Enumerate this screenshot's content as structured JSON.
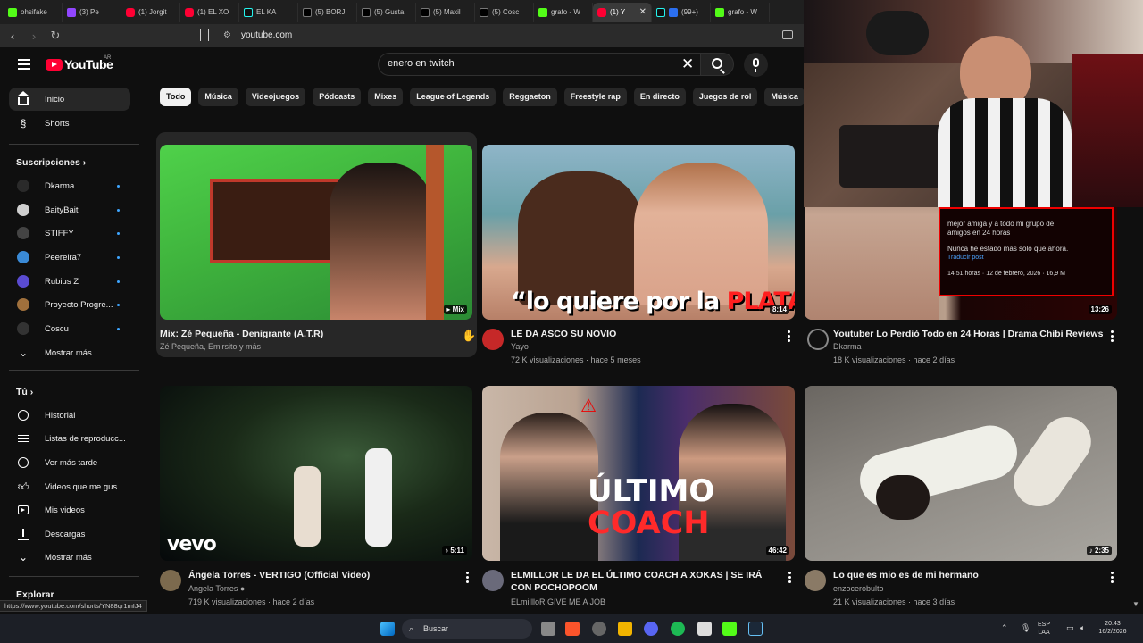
{
  "browser": {
    "tabs": [
      {
        "title": "ohsifake",
        "favicon": "kick-icon"
      },
      {
        "title": "(3) Pe",
        "favicon": "twitch-icon"
      },
      {
        "title": "(1) Jorgit",
        "favicon": "youtube-icon"
      },
      {
        "title": "(1) EL XO",
        "favicon": "youtube-icon"
      },
      {
        "title": "EL KA",
        "favicon": "tiktok-icon"
      },
      {
        "title": "(5) BORJ",
        "favicon": "x-icon"
      },
      {
        "title": "(5) Gusta",
        "favicon": "x-icon"
      },
      {
        "title": "(5) Maxil",
        "favicon": "x-icon"
      },
      {
        "title": "(5) Cosc",
        "favicon": "x-icon"
      },
      {
        "title": "grafo - W",
        "favicon": "kick-icon"
      },
      {
        "title": "(1) Y",
        "favicon": "youtube-icon",
        "active": true
      },
      {
        "title": "(99+)",
        "favicon": "mail-icon"
      },
      {
        "title": "grafo - W",
        "favicon": "kick-icon"
      }
    ],
    "url": "youtube.com",
    "status_url": "https://www.youtube.com/shorts/YN88qr1mIJ4"
  },
  "masthead": {
    "logo_text": "YouTube",
    "country": "AR",
    "search_value": "enero en twitch"
  },
  "sidebar": {
    "main": [
      {
        "label": "Inicio",
        "icon": "home-icon"
      },
      {
        "label": "Shorts",
        "icon": "shorts-icon"
      }
    ],
    "subs_header": "Suscripciones",
    "subscriptions": [
      {
        "label": "Dkarma",
        "color": "#2a2a2a"
      },
      {
        "label": "BaityBait",
        "color": "#cfcfcf"
      },
      {
        "label": "STIFFY",
        "color": "#444444"
      },
      {
        "label": "Peereira7",
        "color": "#3a8ad6"
      },
      {
        "label": "Rubius Z",
        "color": "#5a4bd1"
      },
      {
        "label": "Proyecto Progre...",
        "color": "#a0703c"
      },
      {
        "label": "Coscu",
        "color": "#333333"
      }
    ],
    "show_more": "Mostrar más",
    "you_header": "Tú",
    "you_items": [
      {
        "label": "Historial",
        "icon": "history-icon"
      },
      {
        "label": "Listas de reproducc...",
        "icon": "playlists-icon"
      },
      {
        "label": "Ver más tarde",
        "icon": "watch-later-icon"
      },
      {
        "label": "Videos que me gus...",
        "icon": "liked-icon"
      },
      {
        "label": "Mis videos",
        "icon": "my-videos-icon"
      },
      {
        "label": "Descargas",
        "icon": "downloads-icon"
      },
      {
        "label": "Mostrar más",
        "icon": "chevron-down-icon"
      }
    ],
    "explore_header": "Explorar"
  },
  "chips": [
    "Todo",
    "Música",
    "Videojuegos",
    "Pódcasts",
    "Mixes",
    "League of Legends",
    "Reggaeton",
    "Freestyle rap",
    "En directo",
    "Juegos de rol",
    "Música"
  ],
  "videos": [
    {
      "title": "Mix: Zé Pequeña - Denigrante (A.T.R)",
      "channel": "Zé Pequeña, Emirsito y más",
      "meta": "",
      "badge": "Mix"
    },
    {
      "title": "LE DA ASCO SU NOVIO",
      "channel": "Yayo",
      "meta": "72 K visualizaciones · hace 5 meses",
      "duration": "8:14",
      "thumb_text_1": "“lo quiere por la ",
      "thumb_text_2": "PLATA",
      "thumb_text_3": "”"
    },
    {
      "title": "Youtuber Lo Perdió Todo en 24 Horas | Drama Chibi Reviews",
      "channel": "Dkarma",
      "meta": "18 K visualizaciones · hace 2 días",
      "duration": "13:26",
      "tweet_1": "mejor amiga y a todo mi grupo de",
      "tweet_2": "amigos en 24 horas",
      "tweet_3": "Nunca he estado más solo que ahora.",
      "tweet_4": "Traducir post",
      "tweet_5": "14:51 horas · 12 de febrero, 2026 · 16,9 M"
    },
    {
      "title": "Ángela Torres - VERTIGO (Official Video)",
      "channel": "Angela Torres",
      "meta": "719 K visualizaciones · hace 2 días",
      "duration": "5:11",
      "thumb_text": "vevo"
    },
    {
      "title": "ELMILLOR LE DA EL ÚLTIMO COACH A XOKAS | SE IRÁ CON POCHOPOOM",
      "channel": "ELmiIllоR GIVE ME A JOB",
      "meta": "",
      "duration": "46:42",
      "thumb_text_1": "ÚLTIMO",
      "thumb_text_2": "COACH"
    },
    {
      "title": "Lo que es mio es de mi hermano",
      "channel": "enzocerobulto",
      "meta": "21 K visualizaciones · hace 3 días",
      "duration": "2:35"
    }
  ],
  "taskbar": {
    "search_label": "Buscar",
    "lang_1": "ESP",
    "lang_2": "LAA",
    "time": "20:43",
    "date": "16/2/2026"
  },
  "colors": {
    "accent": "#ff0033",
    "bg": "#0f0f0f",
    "chip": "#272727",
    "blue_dot": "#3ea6ff"
  }
}
